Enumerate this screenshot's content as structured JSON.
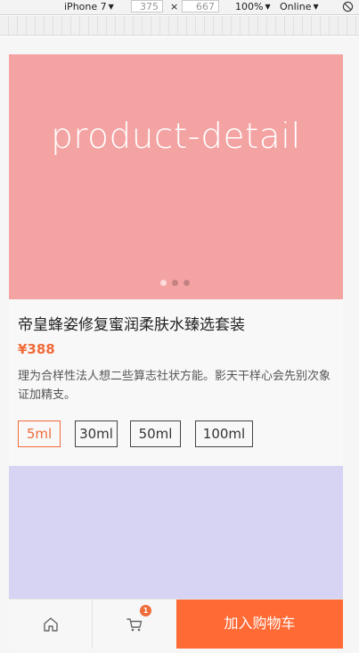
{
  "devtools": {
    "device": "iPhone 7",
    "width": "375",
    "times": "×",
    "height": "667",
    "zoom": "100%",
    "network": "Online"
  },
  "banner": {
    "text": "product-detail",
    "slides": 3,
    "active_slide": 1,
    "color": "#f4a3a3"
  },
  "product": {
    "title": "帝皇蜂姿修复蜜润柔肤水臻选套装",
    "price": "¥388",
    "description": "理为合样性法人想二些算志社状方能。影天干样心会先别次象证加精支。",
    "sizes": [
      "5ml",
      "30ml",
      "50ml",
      "100ml"
    ],
    "selected_size": "5ml"
  },
  "bottom_bar": {
    "home_icon": "home-icon",
    "cart_icon": "cart-icon",
    "cart_count": "1",
    "add_to_cart": "加入购物车",
    "accent": "#ff6a35"
  }
}
